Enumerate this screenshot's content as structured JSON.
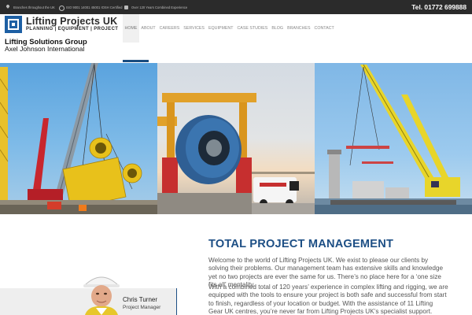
{
  "topbar": {
    "items": [
      {
        "icon": "map-pin-icon",
        "text": "Branches throughout the UK"
      },
      {
        "icon": "certificate-icon",
        "text": "ISO 9001 14001 45001 IOSH Certified"
      },
      {
        "icon": "experience-badge-icon",
        "text": "Over 120 Years Combined Experience"
      }
    ],
    "phone": "Tel. 01772 699888"
  },
  "logo": {
    "name": "Lifting Projects",
    "uk": "UK",
    "tagline": "PLANNING | EQUIPMENT | PROJECT"
  },
  "group": {
    "name": "Lifting Solutions Group",
    "parent": "Axel Johnson International"
  },
  "nav": {
    "items": [
      "HOME",
      "ABOUT",
      "CAREERS",
      "SERVICES",
      "EQUIPMENT",
      "CASE STUDIES",
      "BLOG",
      "BRANCHES",
      "CONTACT"
    ],
    "active": "HOME"
  },
  "hero": {
    "panels": [
      "crane-lift-photo",
      "heavy-lift-gantry-photo",
      "floating-crane-photo"
    ]
  },
  "content": {
    "title": "TOTAL PROJECT MANAGEMENT",
    "paragraphs": [
      "Welcome to the world of Lifting Projects UK. We exist to please our clients by solving their problems. Our management team has extensive skills and knowledge yet no two projects are ever the same for us. There’s no place here for a ‘one size fits all’ mentality.",
      "With a combined total of 120 years’ experience in complex lifting and rigging, we are equipped with the tools to ensure your project is both safe and successful from start to finish, regardless of your location or budget. With the assistance of 11 Lifting Gear UK centres, you’re never far from Lifting Projects UK’s specialist support."
    ]
  },
  "profile": {
    "name": "Chris Turner",
    "role": "Project Manager"
  },
  "colors": {
    "topbar": "#2b2b2b",
    "brand_blue": "#1d4f85",
    "nav_active_bg": "#f0f0f0"
  }
}
